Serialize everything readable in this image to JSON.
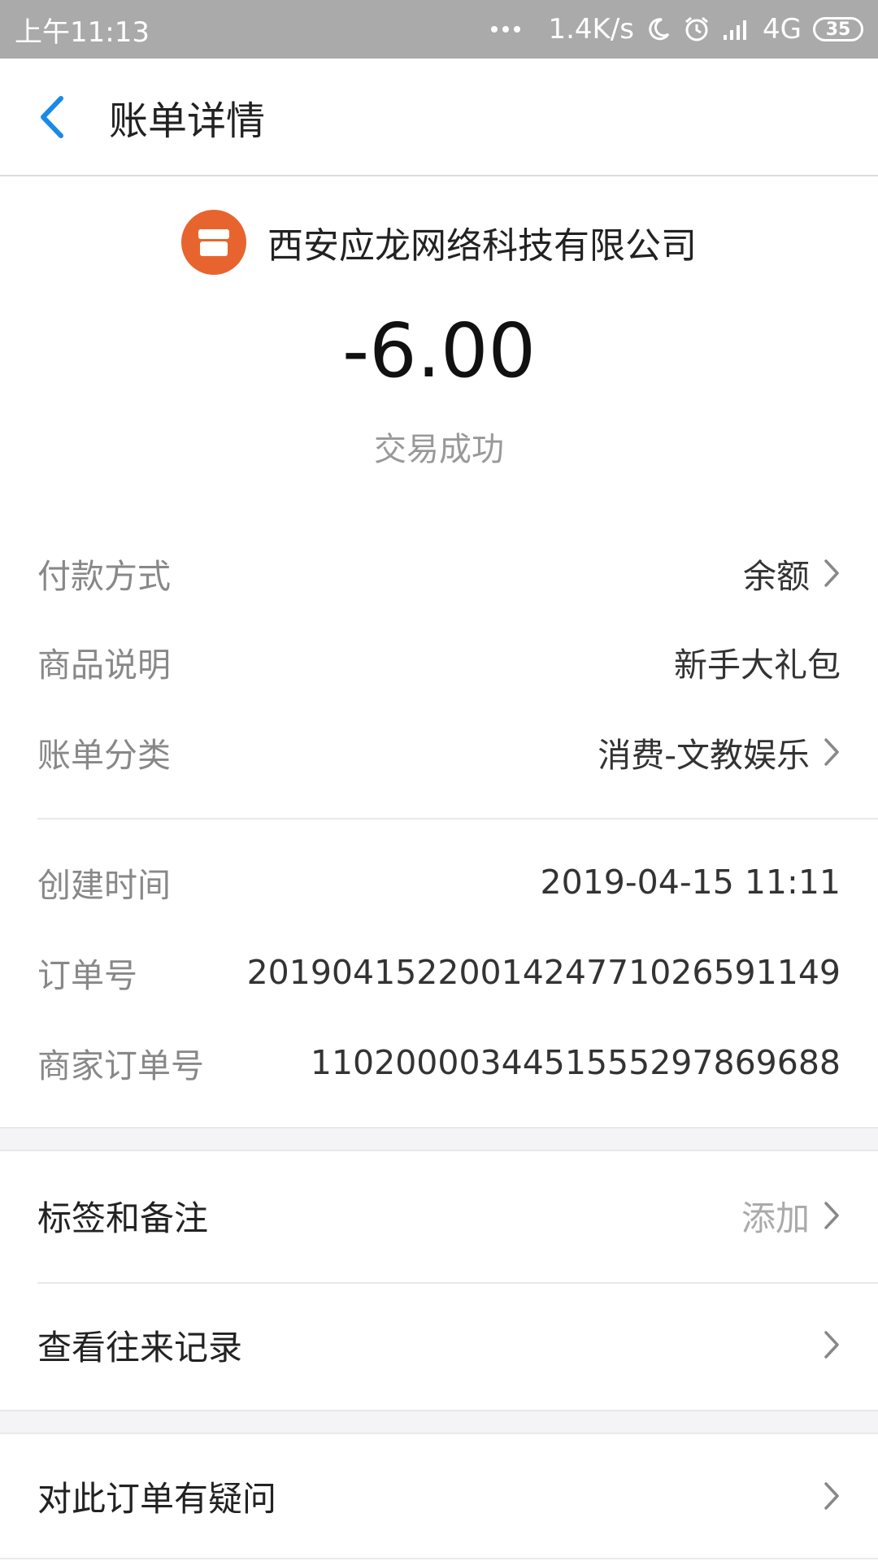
{
  "status_bar": {
    "time": "上午11:13",
    "network_speed": "1.4K/s",
    "network_type": "4G",
    "battery": "35"
  },
  "header": {
    "title": "账单详情"
  },
  "merchant": {
    "name": "西安应龙网络科技有限公司",
    "logo_icon": "shop-icon",
    "logo_color": "#e8642e"
  },
  "amount": "-6.00",
  "status": "交易成功",
  "details": [
    {
      "label": "付款方式",
      "value": "余额"
    },
    {
      "label": "商品说明",
      "value": "新手大礼包"
    },
    {
      "label": "账单分类",
      "value": "消费-文教娱乐"
    }
  ],
  "meta": [
    {
      "label": "创建时间",
      "value": "2019-04-15 11:11"
    },
    {
      "label": "订单号",
      "value": "20190415220014247710265911​49"
    },
    {
      "label": "商家订单号",
      "value": "11020000344515552978696​88"
    }
  ],
  "actions": {
    "tags": {
      "label": "标签和备注",
      "hint": "添加"
    },
    "history": {
      "label": "查看往来记录"
    },
    "question": {
      "label": "对此订单有疑问"
    }
  },
  "colors": {
    "accent": "#1a8ae6",
    "status_bar": "#aaaaaa"
  }
}
